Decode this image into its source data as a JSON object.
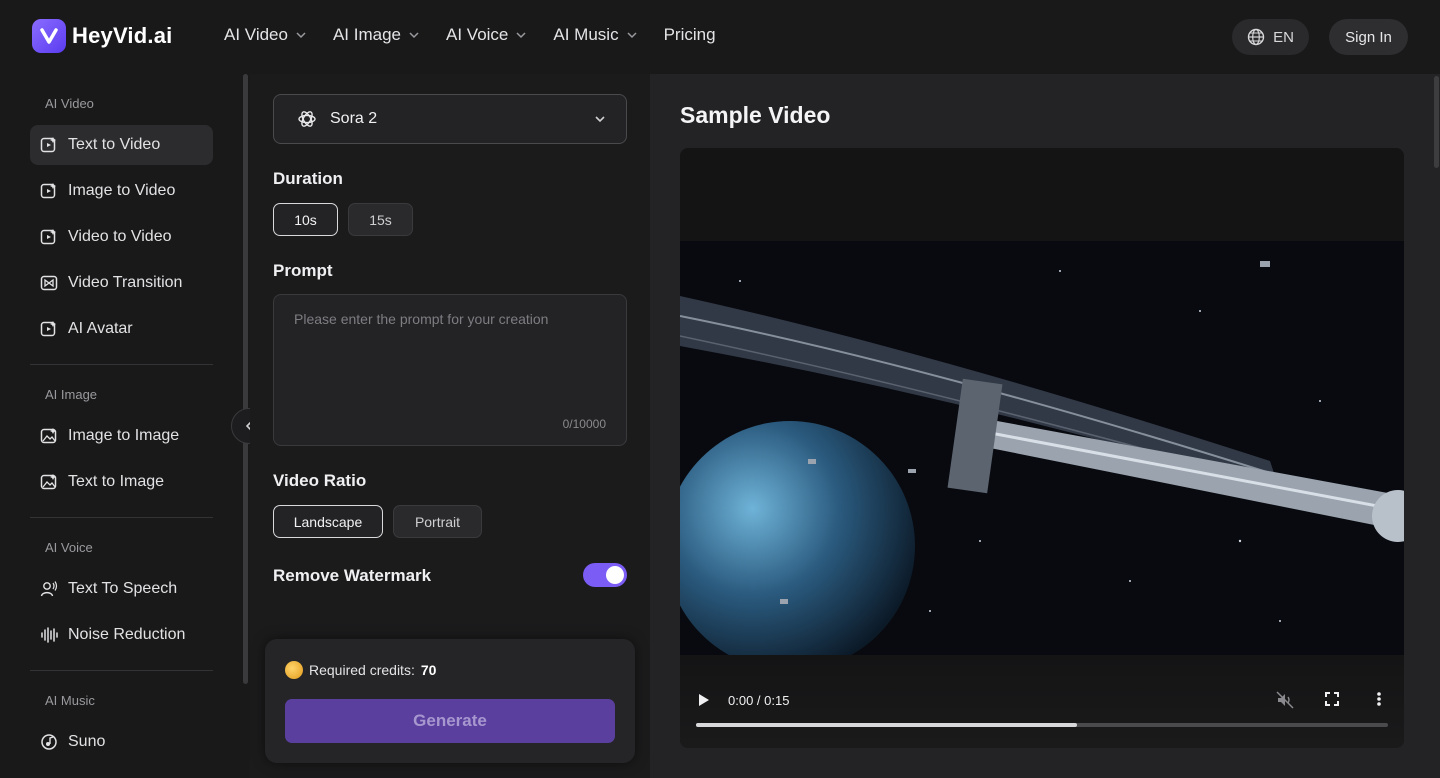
{
  "brand": {
    "name": "HeyVid.ai"
  },
  "nav": [
    {
      "label": "AI Video",
      "has_dropdown": true
    },
    {
      "label": "AI Image",
      "has_dropdown": true
    },
    {
      "label": "AI Voice",
      "has_dropdown": true
    },
    {
      "label": "AI Music",
      "has_dropdown": true
    },
    {
      "label": "Pricing",
      "has_dropdown": false
    }
  ],
  "header": {
    "language": "EN",
    "signin_label": "Sign In"
  },
  "sidebar": {
    "sections": [
      {
        "title": "AI Video",
        "items": [
          {
            "label": "Text to Video",
            "icon": "text-to-video-icon",
            "active": true
          },
          {
            "label": "Image to Video",
            "icon": "image-to-video-icon"
          },
          {
            "label": "Video to Video",
            "icon": "video-to-video-icon"
          },
          {
            "label": "Video Transition",
            "icon": "video-transition-icon"
          },
          {
            "label": "AI Avatar",
            "icon": "ai-avatar-icon"
          }
        ]
      },
      {
        "title": "AI Image",
        "items": [
          {
            "label": "Image to Image",
            "icon": "image-to-image-icon"
          },
          {
            "label": "Text to Image",
            "icon": "text-to-image-icon"
          }
        ]
      },
      {
        "title": "AI Voice",
        "items": [
          {
            "label": "Text To Speech",
            "icon": "text-to-speech-icon"
          },
          {
            "label": "Noise Reduction",
            "icon": "noise-reduction-icon"
          }
        ]
      },
      {
        "title": "AI Music",
        "items": [
          {
            "label": "Suno",
            "icon": "music-note-icon"
          }
        ]
      }
    ]
  },
  "form": {
    "model": "Sora 2",
    "duration_label": "Duration",
    "durations": [
      "10s",
      "15s"
    ],
    "duration_selected": "10s",
    "prompt_label": "Prompt",
    "prompt_placeholder": "Please enter the prompt for your creation",
    "prompt_counter": "0/10000",
    "ratio_label": "Video Ratio",
    "ratios": [
      "Landscape",
      "Portrait"
    ],
    "ratio_selected": "Landscape",
    "watermark_label": "Remove Watermark",
    "watermark_enabled": true,
    "credits_label": "Required credits:",
    "credits_value": "70",
    "generate_label": "Generate"
  },
  "preview": {
    "title": "Sample Video",
    "time": "0:00 / 0:15",
    "progress_fraction": 0.55,
    "muted": true
  },
  "colors": {
    "accent": "#7b5cf5",
    "generate_bg": "#5a3f9e"
  }
}
